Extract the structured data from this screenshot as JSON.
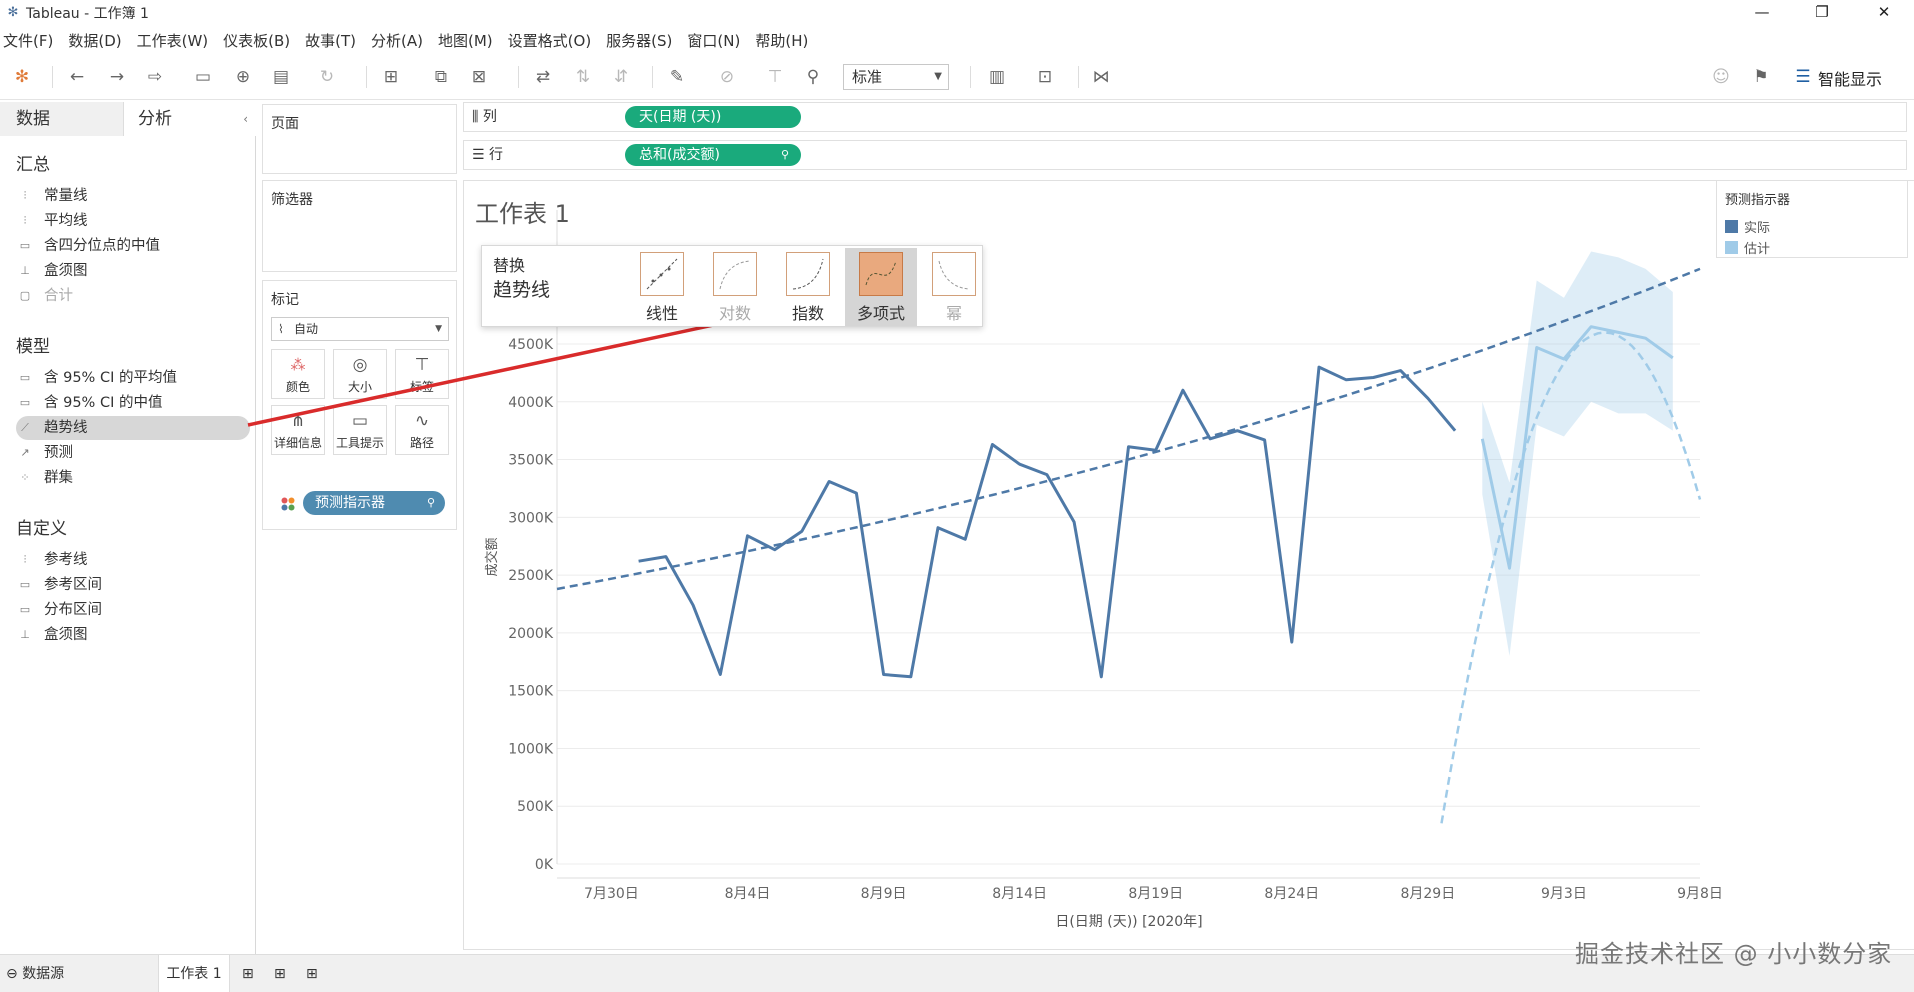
{
  "window": {
    "title": "Tableau - 工作簿 1",
    "minimize_icon": "minimize-icon",
    "maximize_icon": "restore-icon",
    "close_icon": "close-icon"
  },
  "menu": [
    "文件(F)",
    "数据(D)",
    "工作表(W)",
    "仪表板(B)",
    "故事(T)",
    "分析(A)",
    "地图(M)",
    "设置格式(O)",
    "服务器(S)",
    "窗口(N)",
    "帮助(H)"
  ],
  "toolbar": {
    "fit_select": "标准",
    "smart_show": "智能显示"
  },
  "left_pane": {
    "tabs": [
      "数据",
      "分析"
    ],
    "sections": [
      {
        "title": "汇总",
        "items": [
          {
            "label": "常量线",
            "icon": "refline-icon",
            "disabled": false
          },
          {
            "label": "平均线",
            "icon": "refline-icon",
            "disabled": false
          },
          {
            "label": "含四分位点的中值",
            "icon": "band-icon",
            "disabled": false
          },
          {
            "label": "盒须图",
            "icon": "boxplot-icon",
            "disabled": false
          },
          {
            "label": "合计",
            "icon": "totals-icon",
            "disabled": true
          }
        ]
      },
      {
        "title": "模型",
        "items": [
          {
            "label": "含 95% CI 的平均值",
            "icon": "band-icon",
            "disabled": false
          },
          {
            "label": "含 95% CI 的中值",
            "icon": "band-icon",
            "disabled": false
          },
          {
            "label": "趋势线",
            "icon": "trendline-icon",
            "disabled": false,
            "selected": true
          },
          {
            "label": "预测",
            "icon": "forecast-icon",
            "disabled": false
          },
          {
            "label": "群集",
            "icon": "cluster-icon",
            "disabled": false
          }
        ]
      },
      {
        "title": "自定义",
        "items": [
          {
            "label": "参考线",
            "icon": "refline-icon",
            "disabled": false
          },
          {
            "label": "参考区间",
            "icon": "band-icon",
            "disabled": false
          },
          {
            "label": "分布区间",
            "icon": "band-icon",
            "disabled": false
          },
          {
            "label": "盒须图",
            "icon": "boxplot-icon",
            "disabled": false
          }
        ]
      }
    ]
  },
  "cards": {
    "pages": "页面",
    "filters": "筛选器",
    "marks": {
      "title": "标记",
      "mark_type": "自动",
      "buttons": [
        "颜色",
        "大小",
        "标签",
        "详细信息",
        "工具提示",
        "路径"
      ],
      "pill": "预测指示器"
    }
  },
  "shelves": {
    "columns_label": "列",
    "columns_pill": "天(日期 (天))",
    "rows_label": "行",
    "rows_pill": "总和(成交额)"
  },
  "sheet": {
    "title": "工作表 1"
  },
  "trend_popup": {
    "title_line1": "替换",
    "title_line2": "趋势线",
    "options": [
      {
        "label": "线性",
        "disabled": false,
        "selected": false
      },
      {
        "label": "对数",
        "disabled": true,
        "selected": false
      },
      {
        "label": "指数",
        "disabled": false,
        "selected": false
      },
      {
        "label": "多项式",
        "disabled": false,
        "selected": true
      },
      {
        "label": "幂",
        "disabled": true,
        "selected": false
      }
    ]
  },
  "legend": {
    "title": "预测指示器",
    "items": [
      {
        "label": "实际",
        "color": "#4e79a7"
      },
      {
        "label": "估计",
        "color": "#a0cbe8"
      }
    ]
  },
  "bottom": {
    "datasource": "数据源",
    "sheet_tab": "工作表 1"
  },
  "watermark": "掘金技术社区 @ 小小数分家",
  "chart_data": {
    "type": "line",
    "xlabel": "日(日期 (天)) [2020年]",
    "ylabel": "成交额",
    "x_tick_labels": [
      "7月30日",
      "8月4日",
      "8月9日",
      "8月14日",
      "8月19日",
      "8月24日",
      "8月29日",
      "9月3日",
      "9月8日"
    ],
    "x_range_days_from_jul29": [
      -1,
      41
    ],
    "y_tick_labels": [
      "0K",
      "500K",
      "1000K",
      "1500K",
      "2000K",
      "2500K",
      "3000K",
      "3500K",
      "4000K",
      "4500K"
    ],
    "ylim": [
      0,
      5400000
    ],
    "grid": true,
    "series": [
      {
        "name": "实际",
        "color": "#4e79a7",
        "x": [
          "2020-07-31",
          "2020-08-01",
          "2020-08-02",
          "2020-08-03",
          "2020-08-04",
          "2020-08-05",
          "2020-08-06",
          "2020-08-07",
          "2020-08-08",
          "2020-08-09",
          "2020-08-10",
          "2020-08-11",
          "2020-08-12",
          "2020-08-13",
          "2020-08-14",
          "2020-08-15",
          "2020-08-16",
          "2020-08-17",
          "2020-08-18",
          "2020-08-19",
          "2020-08-20",
          "2020-08-21",
          "2020-08-22",
          "2020-08-23",
          "2020-08-24",
          "2020-08-25",
          "2020-08-26",
          "2020-08-27",
          "2020-08-28",
          "2020-08-29",
          "2020-08-30"
        ],
        "y": [
          2620000,
          2660000,
          2240000,
          1640000,
          2840000,
          2720000,
          2880000,
          3310000,
          3210000,
          1640000,
          1620000,
          2910000,
          2810000,
          3630000,
          3460000,
          3370000,
          2960000,
          1620000,
          3610000,
          3580000,
          4100000,
          3680000,
          3750000,
          3670000,
          1920000,
          4300000,
          4190000,
          4210000,
          4270000,
          4030000,
          3750000
        ]
      },
      {
        "name": "估计",
        "color": "#a0cbe8",
        "x": [
          "2020-08-31",
          "2020-09-01",
          "2020-09-02",
          "2020-09-03",
          "2020-09-04",
          "2020-09-05",
          "2020-09-06",
          "2020-09-07"
        ],
        "y": [
          3680000,
          2560000,
          4470000,
          4370000,
          4650000,
          4600000,
          4550000,
          4380000
        ],
        "band_low": [
          3200000,
          1800000,
          3800000,
          3700000,
          4000000,
          3900000,
          3900000,
          3750000
        ],
        "band_high": [
          4000000,
          3300000,
          5050000,
          4900000,
          5300000,
          5250000,
          5150000,
          4950000
        ]
      }
    ],
    "trendlines": [
      {
        "series": "实际",
        "model": "指数",
        "style": "dashed",
        "color": "#4e79a7",
        "from": [
          -1,
          2380000
        ],
        "to": [
          41,
          5150000
        ]
      },
      {
        "series": "估计",
        "model": "多项式",
        "style": "dashed",
        "color": "#a0cbe8"
      }
    ]
  }
}
